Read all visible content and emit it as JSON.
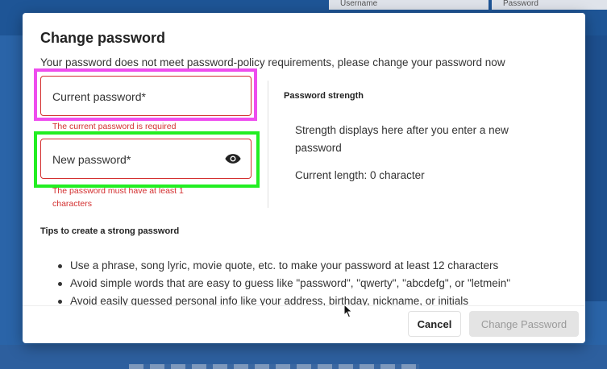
{
  "background": {
    "table_headers": [
      "Username",
      "Password"
    ]
  },
  "dialog": {
    "title": "Change password",
    "message": "Your password does not meet password-policy requirements, please change your password now",
    "current_password": {
      "label": "Current password*",
      "error": "The current password is required"
    },
    "new_password": {
      "label": "New password*",
      "error": "The password must have at least 1 characters",
      "visibility_icon": "eye-icon"
    },
    "strength": {
      "heading": "Password strength",
      "description": "Strength displays here after you enter a new password",
      "length_text": "Current length: 0 character"
    },
    "tips": {
      "heading": "Tips to create a strong password",
      "items": [
        "Use a phrase, song lyric, movie quote, etc. to make your password at least 12 characters",
        "Avoid simple words that are easy to guess like \"password\", \"qwerty\", \"abcdefg\", or \"letmein\"",
        "Avoid easily guessed personal info like your address, birthday, nickname, or initials"
      ]
    },
    "buttons": {
      "cancel": "Cancel",
      "change": "Change Password"
    }
  },
  "colors": {
    "error": "#d32f2f",
    "highlight_current": "#ee4dee",
    "highlight_new": "#22ee22",
    "backdrop": "#2a64a8"
  }
}
